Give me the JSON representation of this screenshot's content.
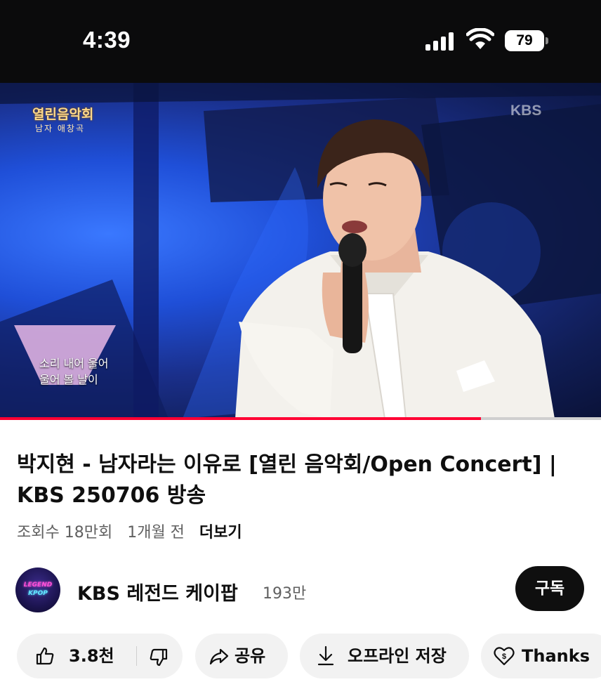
{
  "status_bar": {
    "time": "4:39",
    "battery_level": "79",
    "icons": [
      "signal-icon",
      "wifi-icon",
      "battery-icon"
    ]
  },
  "video": {
    "show_logo": "열린음악회",
    "show_sub": "남자 애창곡",
    "broadcaster_mark": "KBS",
    "lyrics": [
      "소리 내어 울어",
      "울어 볼 날이"
    ],
    "progress_fraction": 0.8,
    "progress_color": "#ff0033"
  },
  "title": "박지현 - 남자라는 이유로 [열린 음악회/Open Concert] | KBS 250706 방송",
  "meta": {
    "views": "조회수 18만회",
    "age": "1개월 전",
    "more": "더보기"
  },
  "channel": {
    "avatar_line1": "LEGEND",
    "avatar_line2": "KPOP",
    "name": "KBS 레전드 케이팝",
    "subscribers": "193만",
    "subscribe_label": "구독"
  },
  "actions": {
    "like_count": "3.8천",
    "share_label": "공유",
    "download_label": "오프라인 저장",
    "thanks_label": "Thanks"
  },
  "colors": {
    "status_bar_bg": "#0b0b0c",
    "pill_bg": "#f2f2f2",
    "subscribe_bg": "#0f0f0f",
    "accent_red": "#ff0033"
  }
}
